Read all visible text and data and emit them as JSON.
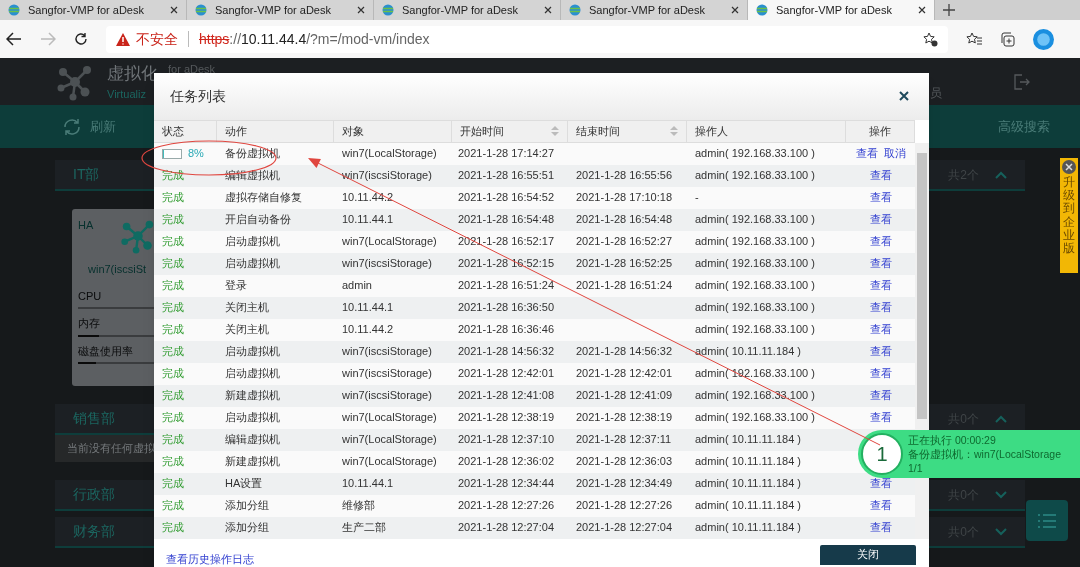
{
  "browser": {
    "tabs": [
      {
        "title": "Sangfor-VMP for aDesk",
        "selected": false
      },
      {
        "title": "Sangfor-VMP for aDesk",
        "selected": false
      },
      {
        "title": "Sangfor-VMP for aDesk",
        "selected": false
      },
      {
        "title": "Sangfor-VMP for aDesk",
        "selected": false
      },
      {
        "title": "Sangfor-VMP for aDesk",
        "selected": true
      }
    ],
    "address": {
      "warning": "不安全",
      "url": [
        {
          "text": "https",
          "kind": "scheme"
        },
        {
          "text": "://",
          "kind": "path"
        },
        {
          "text": "10.11.44.4",
          "kind": "host"
        },
        {
          "text": "/?m=/mod-vm/index",
          "kind": "path"
        }
      ]
    }
  },
  "app": {
    "title": "虚拟化",
    "subtitle": "Virtualiz",
    "edition": "for aDesk",
    "user_fragment": "员",
    "toolbar": {
      "refresh": "刷新",
      "advanced_search": "高级搜索"
    },
    "groups": [
      {
        "name": "IT部",
        "count": "共2个",
        "expanded": true,
        "vms": [
          {
            "tag": "HA",
            "name": "win7(iscsiSt",
            "metrics": [
              {
                "label": "CPU"
              },
              {
                "label": "内存",
                "level": 0.09
              },
              {
                "label": "磁盘使用率",
                "level": 0.08
              }
            ]
          }
        ]
      },
      {
        "name": "销售部",
        "count": "共0个",
        "expanded": true,
        "empty_message": "当前没有任何虚拟"
      },
      {
        "name": "行政部",
        "count": "共0个",
        "expanded": false
      },
      {
        "name": "财务部",
        "count": "共0个",
        "expanded": false
      }
    ]
  },
  "task_dialog": {
    "title": "任务列表",
    "columns": [
      {
        "label": "状态",
        "sortable": false
      },
      {
        "label": "动作",
        "sortable": false
      },
      {
        "label": "对象",
        "sortable": false
      },
      {
        "label": "开始时间",
        "sortable": true
      },
      {
        "label": "结束时间",
        "sortable": true
      },
      {
        "label": "操作人",
        "sortable": false
      },
      {
        "label": "操作",
        "sortable": false
      }
    ],
    "rows": [
      {
        "status": {
          "kind": "running",
          "level": 0.08,
          "percent": "8%"
        },
        "action": "备份虚拟机",
        "object": "win7(LocalStorage)",
        "start": "2021-1-28 17:14:27",
        "operator": "admin( 192.168.33.100 )",
        "actions": [
          "查看",
          "取消"
        ]
      },
      {
        "status": {
          "kind": "done",
          "text": "完成"
        },
        "action": "编辑虚拟机",
        "object": "win7(iscsiStorage)",
        "start": "2021-1-28 16:55:51",
        "end": "2021-1-28 16:55:56",
        "operator": "admin( 192.168.33.100 )",
        "actions": [
          "查看"
        ]
      },
      {
        "status": {
          "kind": "done",
          "text": "完成"
        },
        "action": "虚拟存储自修复",
        "object": "10.11.44.2",
        "start": "2021-1-28 16:54:52",
        "end": "2021-1-28 17:10:18",
        "operator": "-",
        "actions": [
          "查看"
        ]
      },
      {
        "status": {
          "kind": "done",
          "text": "完成"
        },
        "action": "开启自动备份",
        "object": "10.11.44.1",
        "start": "2021-1-28 16:54:48",
        "end": "2021-1-28 16:54:48",
        "operator": "admin( 192.168.33.100 )",
        "actions": [
          "查看"
        ]
      },
      {
        "status": {
          "kind": "done",
          "text": "完成"
        },
        "action": "启动虚拟机",
        "object": "win7(LocalStorage)",
        "start": "2021-1-28 16:52:17",
        "end": "2021-1-28 16:52:27",
        "operator": "admin( 192.168.33.100 )",
        "actions": [
          "查看"
        ]
      },
      {
        "status": {
          "kind": "done",
          "text": "完成"
        },
        "action": "启动虚拟机",
        "object": "win7(iscsiStorage)",
        "start": "2021-1-28 16:52:15",
        "end": "2021-1-28 16:52:25",
        "operator": "admin( 192.168.33.100 )",
        "actions": [
          "查看"
        ]
      },
      {
        "status": {
          "kind": "done",
          "text": "完成"
        },
        "action": "登录",
        "object": "admin",
        "start": "2021-1-28 16:51:24",
        "end": "2021-1-28 16:51:24",
        "operator": "admin( 192.168.33.100 )",
        "actions": [
          "查看"
        ]
      },
      {
        "status": {
          "kind": "done",
          "text": "完成"
        },
        "action": "关闭主机",
        "object": "10.11.44.1",
        "start": "2021-1-28 16:36:50",
        "operator": "admin( 192.168.33.100 )",
        "actions": [
          "查看"
        ]
      },
      {
        "status": {
          "kind": "done",
          "text": "完成"
        },
        "action": "关闭主机",
        "object": "10.11.44.2",
        "start": "2021-1-28 16:36:46",
        "operator": "admin( 192.168.33.100 )",
        "actions": [
          "查看"
        ]
      },
      {
        "status": {
          "kind": "done",
          "text": "完成"
        },
        "action": "启动虚拟机",
        "object": "win7(iscsiStorage)",
        "start": "2021-1-28 14:56:32",
        "end": "2021-1-28 14:56:32",
        "operator": "admin( 10.11.11.184 )",
        "actions": [
          "查看"
        ]
      },
      {
        "status": {
          "kind": "done",
          "text": "完成"
        },
        "action": "启动虚拟机",
        "object": "win7(iscsiStorage)",
        "start": "2021-1-28 12:42:01",
        "end": "2021-1-28 12:42:01",
        "operator": "admin( 192.168.33.100 )",
        "actions": [
          "查看"
        ]
      },
      {
        "status": {
          "kind": "done",
          "text": "完成"
        },
        "action": "新建虚拟机",
        "object": "win7(iscsiStorage)",
        "start": "2021-1-28 12:41:08",
        "end": "2021-1-28 12:41:09",
        "operator": "admin( 192.168.33.100 )",
        "actions": [
          "查看"
        ]
      },
      {
        "status": {
          "kind": "done",
          "text": "完成"
        },
        "action": "启动虚拟机",
        "object": "win7(LocalStorage)",
        "start": "2021-1-28 12:38:19",
        "end": "2021-1-28 12:38:19",
        "operator": "admin( 192.168.33.100 )",
        "actions": [
          "查看"
        ]
      },
      {
        "status": {
          "kind": "done",
          "text": "完成"
        },
        "action": "编辑虚拟机",
        "object": "win7(LocalStorage)",
        "start": "2021-1-28 12:37:10",
        "end": "2021-1-28 12:37:11",
        "operator": "admin( 10.11.11.184 )"
      },
      {
        "status": {
          "kind": "done",
          "text": "完成"
        },
        "action": "新建虚拟机",
        "object": "win7(LocalStorage)",
        "start": "2021-1-28 12:36:02",
        "end": "2021-1-28 12:36:03",
        "operator": "admin( 10.11.11.184 )"
      },
      {
        "status": {
          "kind": "done",
          "text": "完成"
        },
        "action": "HA设置",
        "object": "10.11.44.1",
        "start": "2021-1-28 12:34:44",
        "end": "2021-1-28 12:34:49",
        "operator": "admin( 10.11.11.184 )",
        "actions": [
          "查看"
        ]
      },
      {
        "status": {
          "kind": "done",
          "text": "完成"
        },
        "action": "添加分组",
        "object": "维修部",
        "start": "2021-1-28 12:27:26",
        "end": "2021-1-28 12:27:26",
        "operator": "admin( 10.11.11.184 )",
        "actions": [
          "查看"
        ]
      },
      {
        "status": {
          "kind": "done",
          "text": "完成"
        },
        "action": "添加分组",
        "object": "生产二部",
        "start": "2021-1-28 12:27:04",
        "end": "2021-1-28 12:27:04",
        "operator": "admin( 10.11.11.184 )",
        "actions": [
          "查看"
        ]
      }
    ],
    "history_link": "查看历史操作日志",
    "close_button": "关闭"
  },
  "toast": {
    "badge": "1",
    "lines": [
      "正在执行 00:00:29",
      "备份虚拟机：win7(LocalStorage",
      "1/1"
    ]
  },
  "upgrade_badge": "升级到企业版"
}
